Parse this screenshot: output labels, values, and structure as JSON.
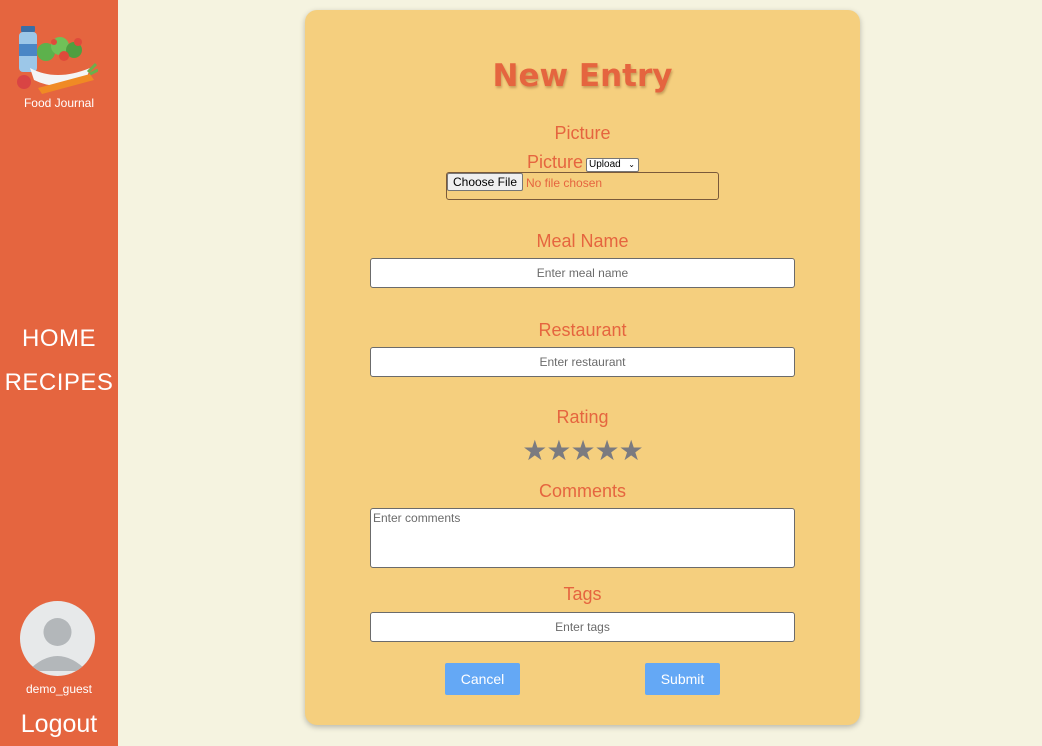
{
  "sidebar": {
    "logo_icon": "food-journal-logo",
    "logo_text": "Food Journal",
    "nav": [
      {
        "label": "HOME"
      },
      {
        "label": "RECIPES"
      }
    ],
    "username": "demo_guest",
    "logout_label": "Logout",
    "bg_color": "#e5653f"
  },
  "form": {
    "title": "New Entry",
    "picture": {
      "label": "Picture",
      "sublabel": "Picture",
      "source_select": "Upload",
      "file_button": "Choose File",
      "file_status": "No file chosen"
    },
    "meal_name": {
      "label": "Meal Name",
      "placeholder": "Enter meal name"
    },
    "restaurant": {
      "label": "Restaurant",
      "placeholder": "Enter restaurant"
    },
    "rating": {
      "label": "Rating",
      "stars": [
        "★",
        "★",
        "★",
        "★",
        "★"
      ],
      "value": 0,
      "max": 5
    },
    "comments": {
      "label": "Comments",
      "placeholder": "Enter comments"
    },
    "tags": {
      "label": "Tags",
      "placeholder": "Enter tags"
    },
    "cancel_label": "Cancel",
    "submit_label": "Submit",
    "accent_color": "#e5653f",
    "card_color": "#f5cf7e",
    "button_color": "#64a8f5"
  }
}
